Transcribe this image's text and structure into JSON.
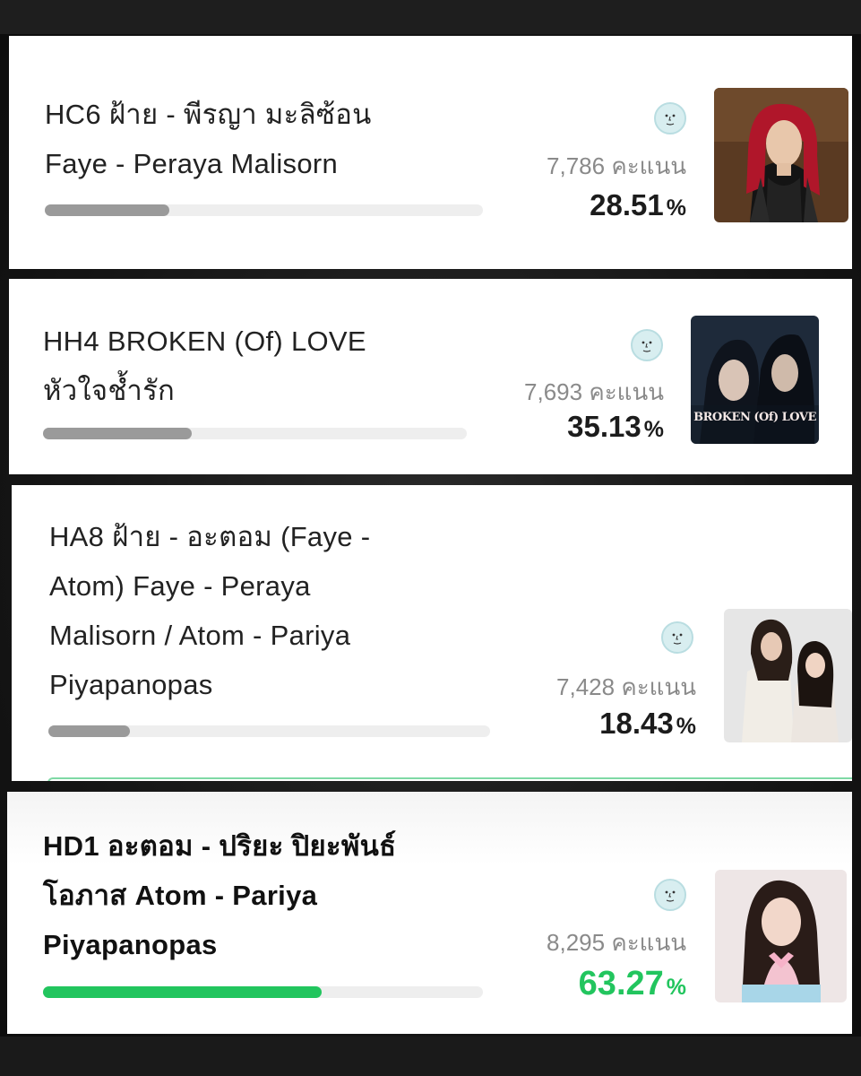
{
  "colors": {
    "winner": "#22c55e",
    "bar_default": "#9a9a9a",
    "track": "#eeeeee"
  },
  "entries": [
    {
      "title_lines": [
        "HC6 ฝ้าย - พีรญา มะลิซ้อน",
        "Faye - Peraya Malisorn"
      ],
      "votes": "7,786",
      "votes_unit": "คะแนน",
      "percent": "28.51",
      "percent_sign": "%",
      "progress_fraction": 0.2851,
      "icon": "face-badge-icon",
      "photo": "nominee-photo-red-hair"
    },
    {
      "title_lines": [
        "HH4 BROKEN (Of) LOVE",
        "หัวใจช้ำรัก"
      ],
      "votes": "7,693",
      "votes_unit": "คะแนน",
      "percent": "35.13",
      "percent_sign": "%",
      "progress_fraction": 0.3513,
      "icon": "face-badge-icon",
      "photo": "series-poster-broken-of-love",
      "photo_text": "BROKEN (Of) LOVE"
    },
    {
      "title_lines": [
        "HA8 ฝ้าย - อะตอม (Faye -",
        "Atom) Faye - Peraya",
        "Malisorn / Atom - Pariya",
        "Piyapanopas"
      ],
      "votes": "7,428",
      "votes_unit": "คะแนน",
      "percent": "18.43",
      "percent_sign": "%",
      "progress_fraction": 0.1843,
      "icon": "face-badge-icon",
      "photo": "duo-photo-faye-atom"
    },
    {
      "title_lines": [
        "HD1 อะตอม - ปริยะ ปิยะพันธ์",
        "โอภาส Atom - Pariya",
        "Piyapanopas"
      ],
      "votes": "8,295",
      "votes_unit": "คะแนน",
      "percent": "63.27",
      "percent_sign": "%",
      "progress_fraction": 0.6327,
      "icon": "face-badge-icon",
      "photo": "nominee-photo-atom",
      "winner": true
    }
  ]
}
